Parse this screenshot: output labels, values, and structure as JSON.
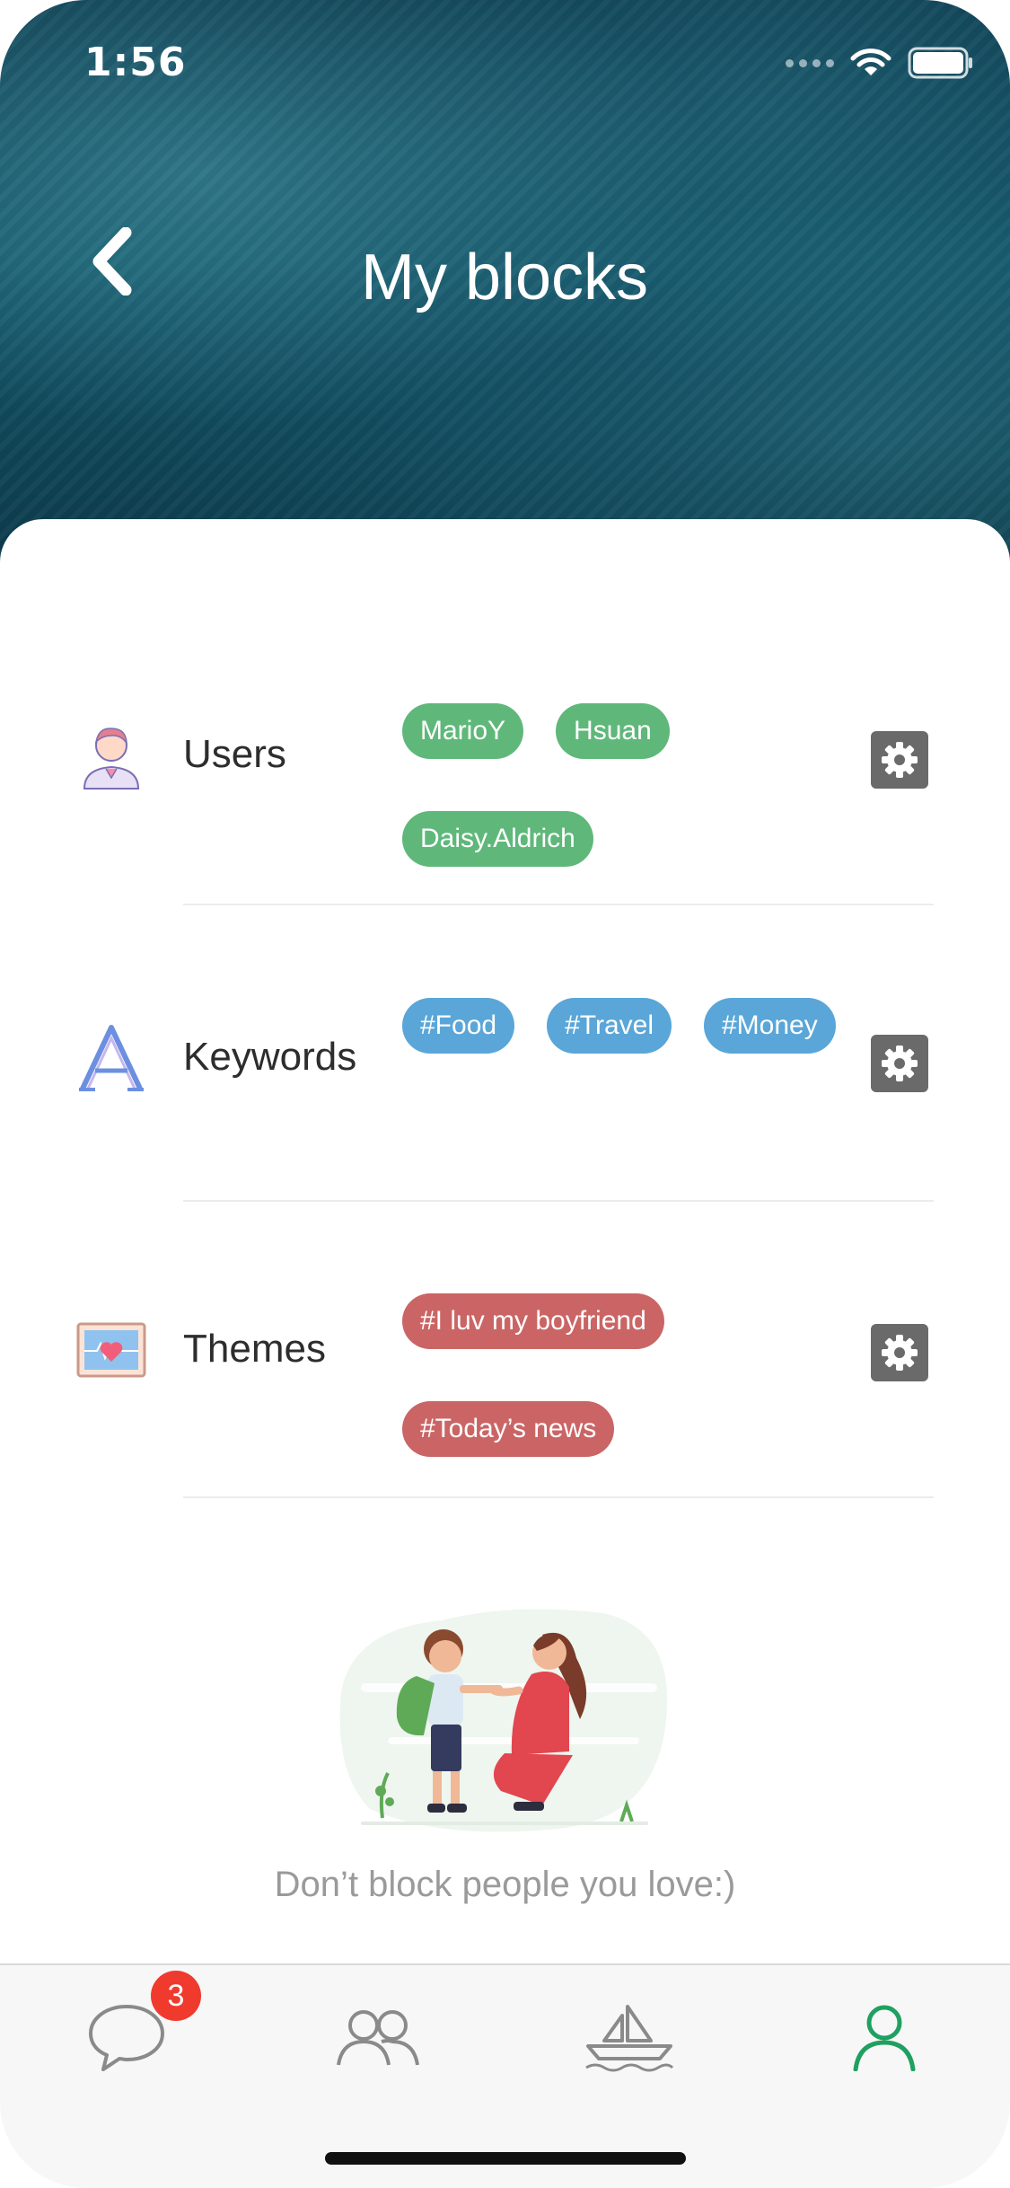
{
  "status_bar": {
    "time": "1:56"
  },
  "header": {
    "title": "My blocks"
  },
  "sections": [
    {
      "label": "Users",
      "icon": "user-icon",
      "tag_color": "#5fb87a",
      "tags": [
        "MarioY",
        "Hsuan",
        "Daisy.Aldrich"
      ]
    },
    {
      "label": "Keywords",
      "icon": "keyword-letter-icon",
      "tag_color": "#5aa6d8",
      "tags": [
        "#Food",
        "#Travel",
        "#Money"
      ]
    },
    {
      "label": "Themes",
      "icon": "heart-picture-icon",
      "tag_color": "#cb6565",
      "tags": [
        "#I luv my boyfriend",
        "#Today’s news"
      ]
    }
  ],
  "caption": "Don’t block people you love:)",
  "tabbar": {
    "tabs": [
      {
        "icon": "chat-bubble-icon",
        "active": false
      },
      {
        "icon": "friends-icon",
        "active": false
      },
      {
        "icon": "boat-icon",
        "active": false
      },
      {
        "icon": "profile-icon",
        "active": true
      }
    ],
    "chat_badge": "3",
    "active_color": "#1fa060",
    "inactive_color": "#8a8a8a"
  }
}
